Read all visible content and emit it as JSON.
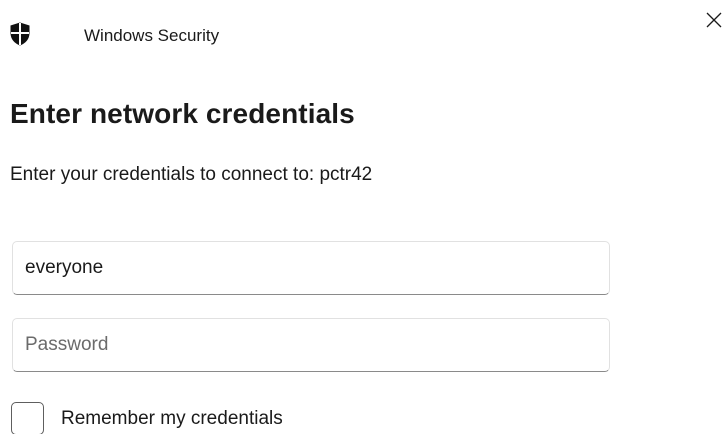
{
  "window": {
    "title": "Windows Security",
    "close_icon": "close-icon",
    "app_icon": "shield-icon"
  },
  "dialog": {
    "heading": "Enter network credentials",
    "subtitle": "Enter your credentials to connect to: pctr42"
  },
  "fields": {
    "username": {
      "value": "everyone",
      "placeholder": ""
    },
    "password": {
      "value": "",
      "placeholder": "Password"
    }
  },
  "remember": {
    "label": "Remember my credentials",
    "checked": false
  },
  "colors": {
    "text": "#1a1a1a",
    "border": "#e1e1e1",
    "input_underline": "#8a8a8a",
    "placeholder": "#6b6b6b"
  }
}
